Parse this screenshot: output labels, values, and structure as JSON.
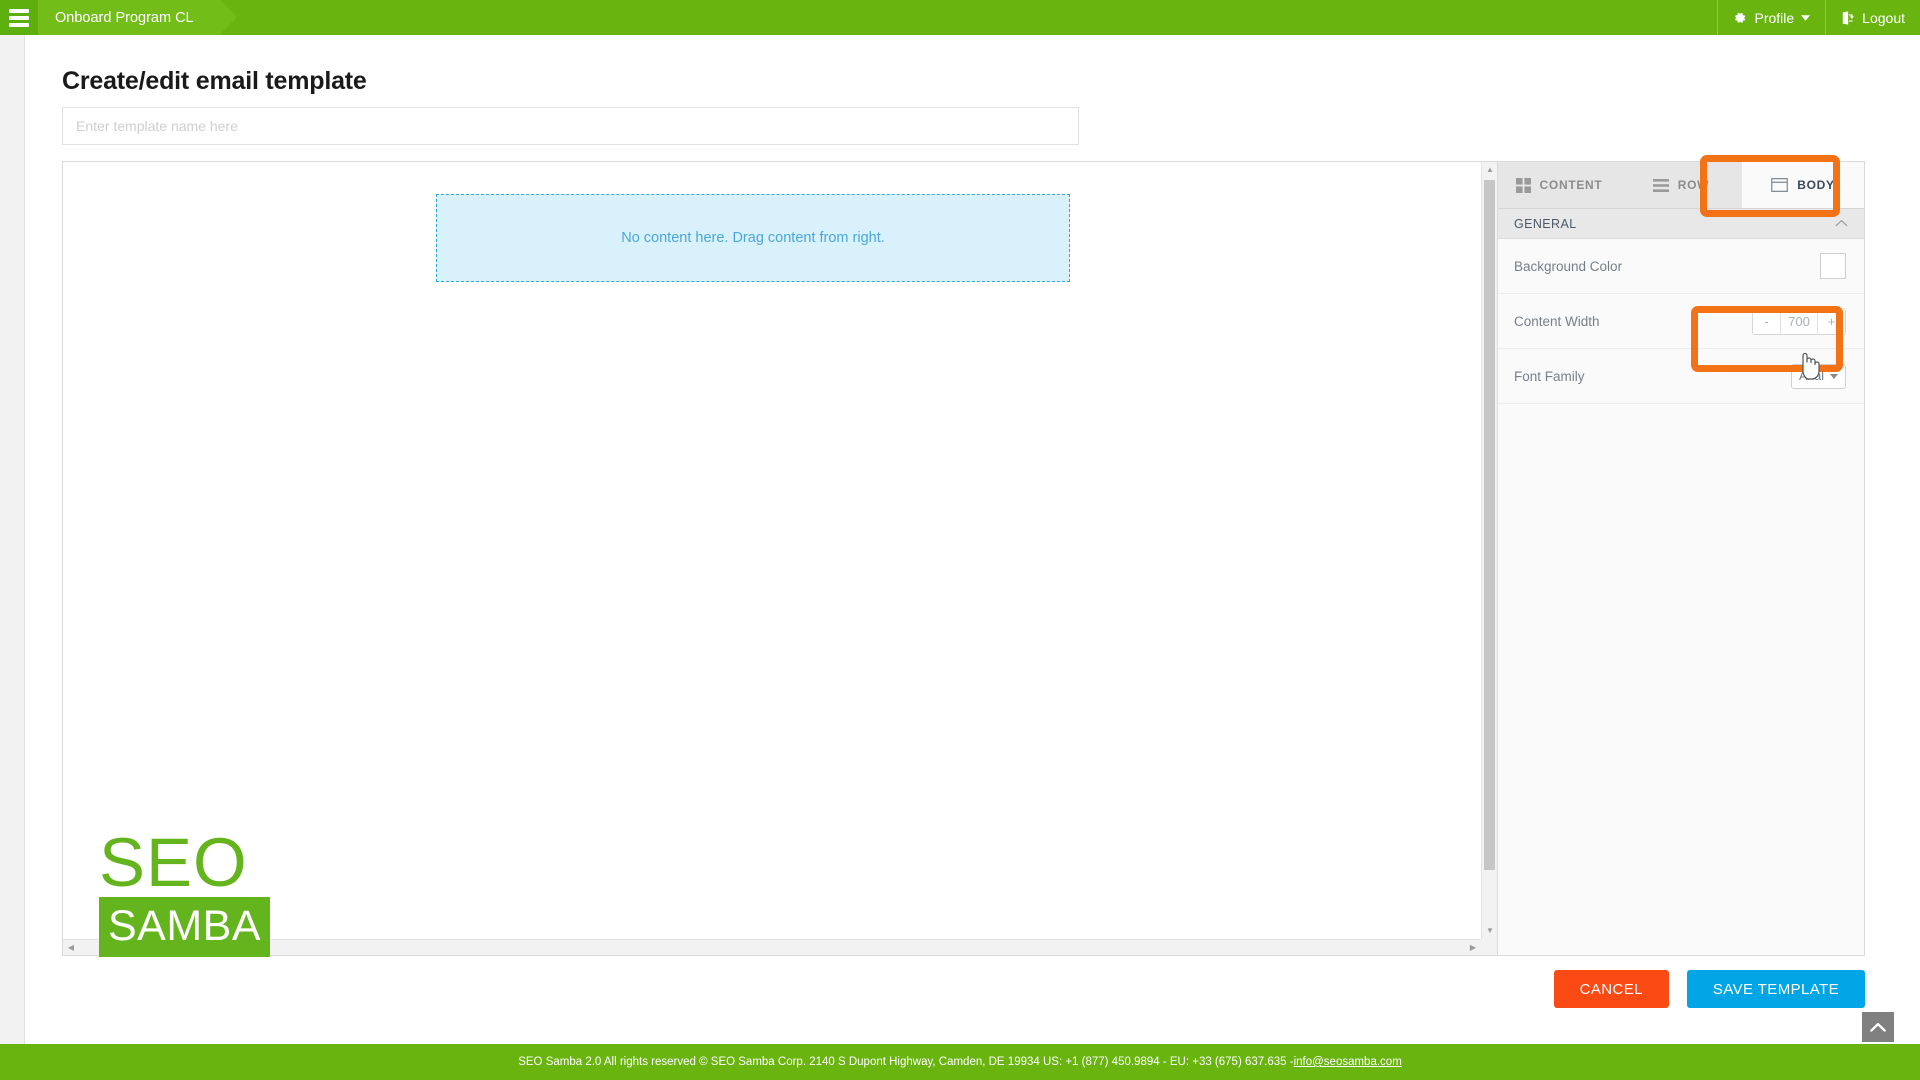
{
  "topbar": {
    "menu_icon": "hamburger-icon",
    "breadcrumb": "Onboard Program CL",
    "profile_label": "Profile",
    "profile_icon": "gear-icon",
    "profile_caret": "chevron-down-icon",
    "logout_label": "Logout",
    "logout_icon": "logout-icon",
    "bg_color": "#69b40f"
  },
  "page": {
    "title": "Create/edit email template",
    "template_name_value": "",
    "template_name_placeholder": "Enter template name here"
  },
  "canvas": {
    "dropzone_text": "No content here. Drag content from right.",
    "dropzone_bg": "#d9f1fb",
    "dropzone_border": "#35a6d8",
    "scroll_up_icon": "triangle-up-icon",
    "scroll_down_icon": "triangle-down-icon",
    "scroll_left_icon": "triangle-left-icon",
    "scroll_right_icon": "triangle-right-icon"
  },
  "logo": {
    "line1": "SEO",
    "line2": "SAMBA",
    "color": "#64b41e"
  },
  "panel": {
    "tabs": [
      {
        "label": "CONTENT",
        "icon": "grid-icon",
        "active": false
      },
      {
        "label": "ROW",
        "icon": "rows-icon",
        "active": false
      },
      {
        "label": "BODY",
        "icon": "body-rectangle-icon",
        "active": true
      }
    ],
    "section": {
      "title": "GENERAL",
      "collapse_icon": "chevron-up-icon"
    },
    "settings": {
      "background_color_label": "Background Color",
      "background_color_value": "#ffffff",
      "content_width_label": "Content Width",
      "content_width_value": "700",
      "content_width_minus": "-",
      "content_width_plus": "+",
      "font_family_label": "Font Family",
      "font_family_value": "Arial",
      "font_family_caret": "caret-down-icon"
    }
  },
  "highlights": {
    "color": "#f47216",
    "body_tab": "BODY",
    "content_width_stepper": "Content Width stepper"
  },
  "actions": {
    "cancel_label": "CANCEL",
    "cancel_color": "#fb4a14",
    "save_label": "SAVE TEMPLATE",
    "save_color": "#00a5e5"
  },
  "scroll_top": {
    "icon": "chevron-up-icon"
  },
  "footer": {
    "text": "SEO Samba 2.0  All rights reserved © SEO Samba Corp. 2140 S Dupont Highway, Camden, DE 19934 US: +1 (877) 450.9894 - EU: +33 (675) 637.635 - ",
    "email": "info@seosamba.com"
  }
}
